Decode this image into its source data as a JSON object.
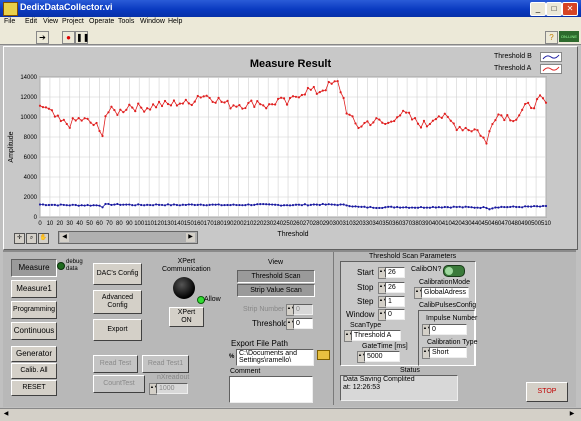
{
  "window": {
    "title": "DedixDataCollector.vi"
  },
  "menu": [
    "File",
    "Edit",
    "View",
    "Project",
    "Operate",
    "Tools",
    "Window",
    "Help"
  ],
  "toolbar": {
    "run_icon": "run-arrow-icon",
    "stop_icon": "abort-icon",
    "pause_icon": "pause-icon"
  },
  "chart_data": {
    "type": "line",
    "title": "Measure Result",
    "xlabel": "Threshold",
    "ylabel": "Amplitude",
    "xlim": [
      0,
      510
    ],
    "ylim": [
      0,
      14000
    ],
    "xticks": [
      0,
      10,
      20,
      30,
      40,
      50,
      60,
      70,
      80,
      90,
      100,
      110,
      120,
      130,
      140,
      150,
      160,
      170,
      180,
      190,
      200,
      210,
      220,
      230,
      240,
      250,
      260,
      270,
      280,
      290,
      300,
      310,
      320,
      330,
      340,
      350,
      360,
      370,
      380,
      390,
      400,
      410,
      420,
      430,
      440,
      450,
      460,
      470,
      480,
      490,
      500,
      510
    ],
    "yticks": [
      0,
      2000,
      4000,
      6000,
      8000,
      10000,
      12000,
      14000
    ],
    "grid": true,
    "legend_position": "top-right",
    "series": [
      {
        "name": "Threshold B",
        "color": "#1a1aa0",
        "x": [
          0,
          20,
          40,
          60,
          62,
          64,
          80,
          100,
          120,
          140,
          160,
          180,
          200,
          220,
          240,
          260,
          280,
          300,
          310,
          320,
          340,
          360,
          380,
          400,
          420,
          440,
          450,
          452,
          460,
          480,
          500,
          510
        ],
        "y": [
          1250,
          1200,
          1180,
          1170,
          800,
          1250,
          1250,
          1200,
          1230,
          1200,
          1250,
          1200,
          1200,
          1250,
          1200,
          1200,
          1250,
          1230,
          1180,
          1000,
          950,
          1000,
          950,
          1000,
          1000,
          950,
          950,
          800,
          1000,
          1000,
          1050,
          1050
        ]
      },
      {
        "name": "Threshold A",
        "color": "#e02020",
        "x": [
          0,
          10,
          20,
          30,
          40,
          50,
          58,
          60,
          62,
          64,
          70,
          80,
          90,
          100,
          110,
          120,
          130,
          140,
          150,
          160,
          170,
          180,
          190,
          200,
          210,
          220,
          230,
          240,
          250,
          260,
          270,
          280,
          290,
          300,
          305,
          310,
          320,
          330,
          340,
          350,
          360,
          370,
          380,
          390,
          400,
          410,
          420,
          430,
          440,
          445,
          450,
          455,
          460,
          470,
          480,
          490,
          500,
          505,
          510
        ],
        "y": [
          11200,
          10500,
          9500,
          9300,
          9800,
          9500,
          9000,
          8400,
          7000,
          10000,
          10600,
          10500,
          11200,
          10900,
          11000,
          11300,
          11200,
          11500,
          11300,
          12200,
          12100,
          11700,
          11200,
          11300,
          11200,
          11600,
          11000,
          11700,
          11300,
          12300,
          12700,
          12500,
          13100,
          13400,
          12200,
          10300,
          9000,
          9500,
          9600,
          9200,
          10300,
          10200,
          9400,
          9200,
          10300,
          9800,
          9100,
          8900,
          8700,
          8300,
          7200,
          9500,
          10300,
          10100,
          9900,
          11000,
          11400,
          11800,
          11200
        ]
      }
    ]
  },
  "legend": {
    "b_label": "Threshold B",
    "a_label": "Threshold A"
  },
  "left_buttons": [
    "Measure",
    "Measure1",
    "Programming",
    "Continuous",
    "Generator",
    "Calib. All",
    "RESET"
  ],
  "debug": {
    "label": "debug\ndata"
  },
  "config_buttons": [
    "DAC's Config",
    "Advanced\nConfig",
    "Export"
  ],
  "xpert": {
    "label": "XPert\nCommunication",
    "allow_label": "Allow",
    "button": "XPert\nON"
  },
  "view": {
    "label": "View",
    "threshold_scan": "Threshold Scan",
    "strip_value_scan": "Strip Value Scan"
  },
  "strip": {
    "number_label": "Strip Number",
    "number_value": "0",
    "threshold_label": "Threshold",
    "threshold_value": "0"
  },
  "read_buttons": [
    "Read Test",
    "Read Test1",
    "CountTest"
  ],
  "nxreadout": {
    "label": "nXreadout",
    "value": "1000"
  },
  "export": {
    "label": "Export File Path",
    "value": "C:\\Documents and\nSettings\\ramello\\"
  },
  "comment": {
    "label": "Comment",
    "value": ""
  },
  "scan_params": {
    "title": "Threshold Scan Parameters",
    "start_label": "Start",
    "start": "26",
    "stop_label": "Stop",
    "stop": "26",
    "step_label": "Step",
    "step": "1",
    "window_label": "Window",
    "window": "0",
    "scantype_label": "ScanType",
    "scantype": "Threshold A",
    "gatetime_label": "GateTime [ms]",
    "gatetime": "5000",
    "calib_label": "CalibON?",
    "calib_mode_label": "CalibrationMode",
    "calib_mode": "GlobalAdress",
    "calib_pulses_label": "CalibPulsesConfig",
    "impulse_label": "Impulse Number",
    "impulse": "0",
    "calib_type_label": "Calibration Type",
    "calib_type": "Short"
  },
  "status": {
    "label": "Status",
    "text": "Data Saving Complited\nat: 12:26:53"
  },
  "stop_button": "STOP",
  "corner_badge": "ON-LINE"
}
